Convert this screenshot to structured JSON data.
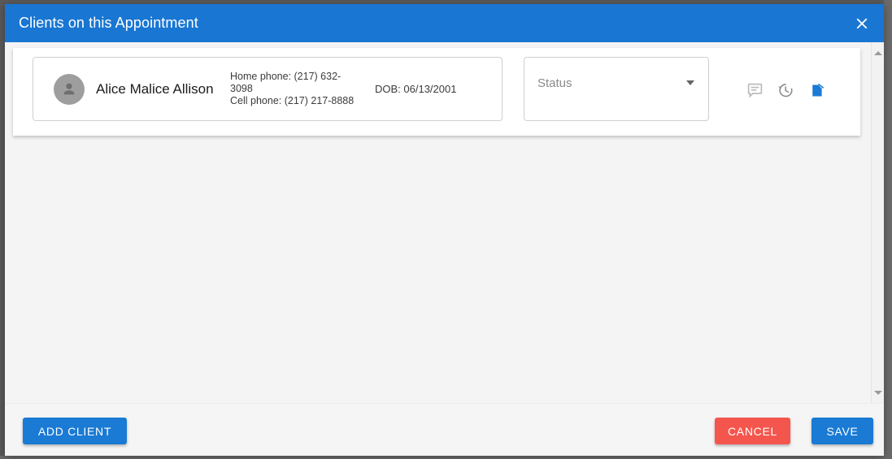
{
  "dialog": {
    "title": "Clients on this Appointment",
    "close_icon": "close-icon",
    "header_color": "#1976d2"
  },
  "clients": [
    {
      "avatar_icon": "person-avatar-icon",
      "name": "Alice Malice Allison",
      "home_phone": "Home phone: (217) 632-3098",
      "cell_phone": "Cell phone: (217) 217-8888",
      "dob": "DOB: 06/13/2001",
      "status": {
        "value": "Status",
        "placeholder": "Status",
        "dropdown_icon": "chevron-down-icon"
      },
      "actions": [
        {
          "name": "comment-icon",
          "label": "Comments",
          "color": "#b5b5b5"
        },
        {
          "name": "history-icon",
          "label": "History",
          "color": "#8c8c8c"
        },
        {
          "name": "document-icon",
          "label": "Documents",
          "color": "#1a7ad4"
        }
      ]
    }
  ],
  "scrollbar": {
    "up_icon": "scroll-up-arrow-icon",
    "down_icon": "scroll-down-arrow-icon"
  },
  "footer": {
    "add_client_label": "ADD CLIENT",
    "cancel_label": "CANCEL",
    "save_label": "SAVE",
    "add_client_color": "#1a7ad4",
    "cancel_color": "#f4564e",
    "save_color": "#1a7ad4"
  }
}
